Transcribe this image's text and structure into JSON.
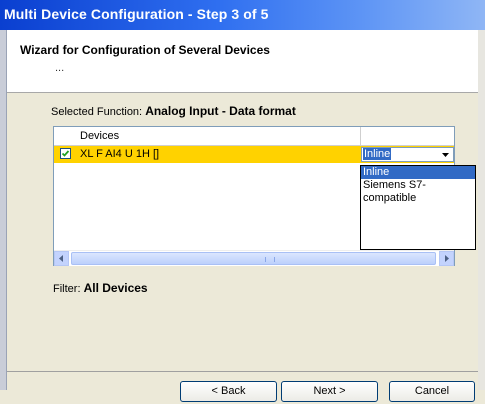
{
  "window": {
    "title": "Multi Device Configuration - Step 3 of 5"
  },
  "header": {
    "title": "Wizard for Configuration of Several Devices",
    "subtitle": "..."
  },
  "selected_function": {
    "label": "Selected Function:",
    "value": "Analog Input  - Data format"
  },
  "list": {
    "column_header": "Devices",
    "rows": [
      {
        "checked": true,
        "device": "XL F AI4 U 1H []",
        "format": "Inline"
      }
    ]
  },
  "dropdown": {
    "options": [
      "Inline",
      "Siemens S7-compatible"
    ],
    "selected": "Inline"
  },
  "filter": {
    "label": "Filter:",
    "value": "All Devices"
  },
  "buttons": {
    "back": "< Back",
    "next": "Next >",
    "cancel": "Cancel"
  },
  "colors": {
    "selected_row": "#ffd200",
    "selection": "#316ac5",
    "title_bar": "#0a3fd0"
  }
}
